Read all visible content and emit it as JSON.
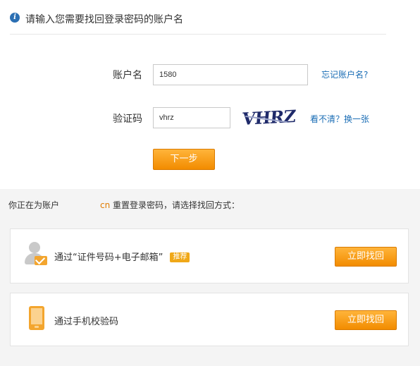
{
  "header": {
    "title": "请输入您需要找回登录密码的账户名"
  },
  "form": {
    "account_label": "账户名",
    "account_value": "1580",
    "forgot_link": "忘记账户名?",
    "captcha_label": "验证码",
    "captcha_value": "vhrz",
    "captcha_image_text": "VHRZ",
    "refresh_link": "看不清？换一张",
    "next_button": "下一步"
  },
  "reset": {
    "prefix": "你正在为账户",
    "account_suffix": "cn",
    "suffix": "重置登录密码，请选择找回方式："
  },
  "methods": [
    {
      "label": "通过“证件号码+电子邮箱”",
      "badge": "推荐",
      "button": "立即找回",
      "icon": "person-mail-icon"
    },
    {
      "label": "通过手机校验码",
      "button": "立即找回",
      "icon": "mobile-phone-icon"
    }
  ],
  "colors": {
    "accent": "#f5a623",
    "link": "#1a6db5",
    "info": "#2b6fb3"
  }
}
